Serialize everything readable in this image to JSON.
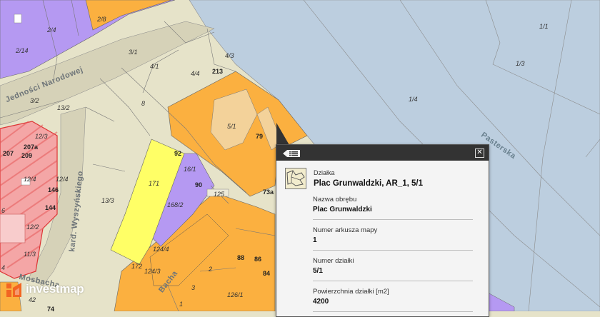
{
  "map": {
    "streets": [
      {
        "name": "Jedności Narodowej"
      },
      {
        "name": "kard. Wyszyńskiego"
      },
      {
        "name": "Mosbacha"
      },
      {
        "name": "Bacha"
      }
    ],
    "river_labels": [
      {
        "name": "Pasterska"
      }
    ],
    "parcel_labels": [
      "2/8",
      "2/4",
      "2/14",
      "3/1",
      "4/1",
      "4/3",
      "4/4",
      "213",
      "3/2",
      "13/2",
      "12/3",
      "207",
      "209",
      "207a",
      "5/1",
      "79",
      "8",
      "92",
      "16/1",
      "90",
      "171",
      "168/2",
      "125",
      "13/3",
      "12/4",
      "12/4",
      "146",
      "144",
      "12/2",
      "11/3",
      "124/4",
      "124/3",
      "172",
      "1/1",
      "1/3",
      "1/4",
      "73a",
      "88",
      "86",
      "84",
      "2",
      "3",
      "1",
      "126/1",
      "74",
      "42",
      "6",
      "4"
    ],
    "colors": {
      "river": "#bccedf",
      "land": "#e6e3c9",
      "orange": "#fbb040",
      "yellow": "#ffff66",
      "purple": "#b599f2",
      "hatched": "#f4a6a6",
      "road": "#d6d2b8"
    }
  },
  "popup": {
    "list_icon": "list-icon",
    "close_icon": "close-icon",
    "parcel_icon": "parcel-map-icon",
    "object_type": "Działka",
    "title": "Plac Grunwaldzki, AR_1, 5/1",
    "fields": [
      {
        "label": "Nazwa obrębu",
        "value": "Plac Grunwaldzki"
      },
      {
        "label": "Numer arkusza mapy",
        "value": "1"
      },
      {
        "label": "Numer działki",
        "value": "5/1"
      },
      {
        "label": "Powierzchnia działki [m2]",
        "value": "4200"
      }
    ]
  },
  "logo": {
    "text": "investmap",
    "colors": {
      "mark": "#f26522"
    }
  }
}
